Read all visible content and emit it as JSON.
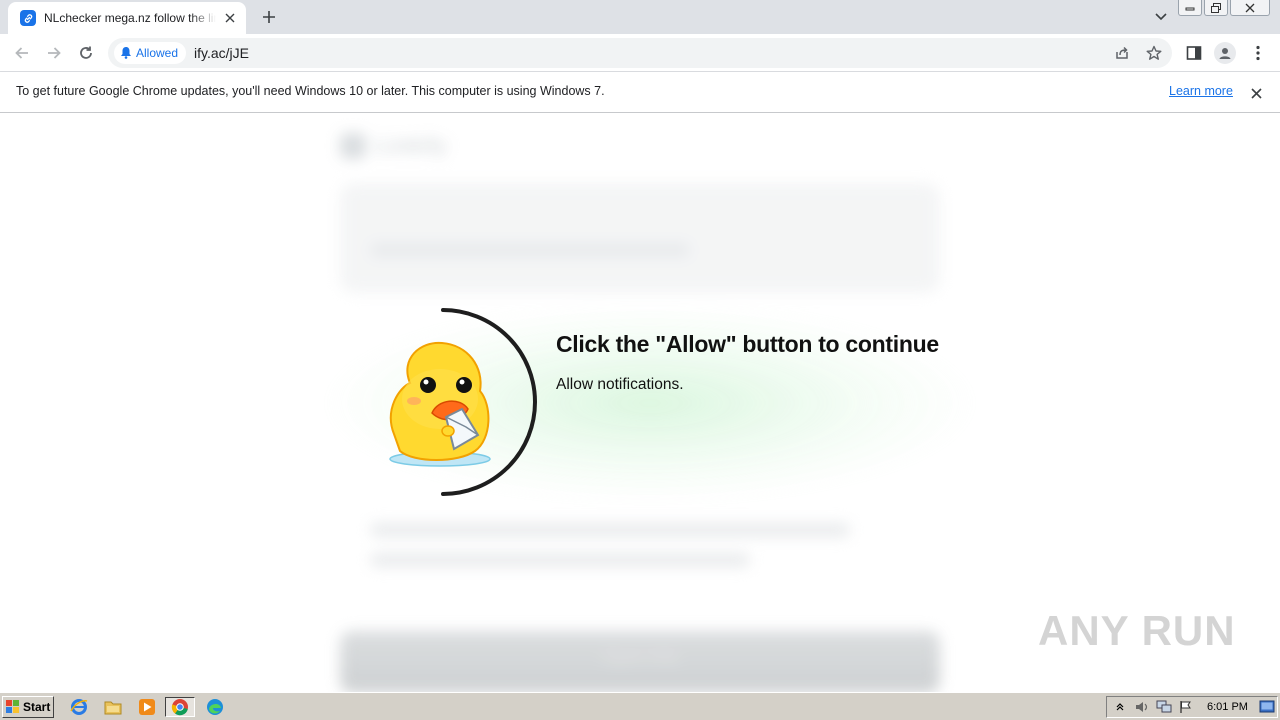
{
  "tab": {
    "title": "NLchecker mega.nz follow the link —",
    "favicon": "link-icon",
    "close_icon": "close-icon"
  },
  "toolbar": {
    "permission_chip": "Allowed",
    "url": "ify.ac/jJE"
  },
  "infobar": {
    "message": "To get future Google Chrome updates, you'll need Windows 10 or later. This computer is using Windows 7.",
    "link": "Learn more"
  },
  "page": {
    "background_logo": "Linkify",
    "overlay_title": "Click the \"Allow\" button to continue",
    "overlay_subtitle": "Allow notifications.",
    "button_label": "Open link",
    "watermark": "ANY RUN"
  },
  "taskbar": {
    "start_label": "Start",
    "clock": "6:01 PM",
    "apps": [
      "internet-explorer-icon",
      "folder-icon",
      "media-player-icon",
      "chrome-icon",
      "edge-icon"
    ]
  },
  "colors": {
    "accent": "#1a73e8",
    "tabstrip": "#dee1e6",
    "taskbar": "#d4d0c8",
    "glow": "#aaebb4"
  }
}
